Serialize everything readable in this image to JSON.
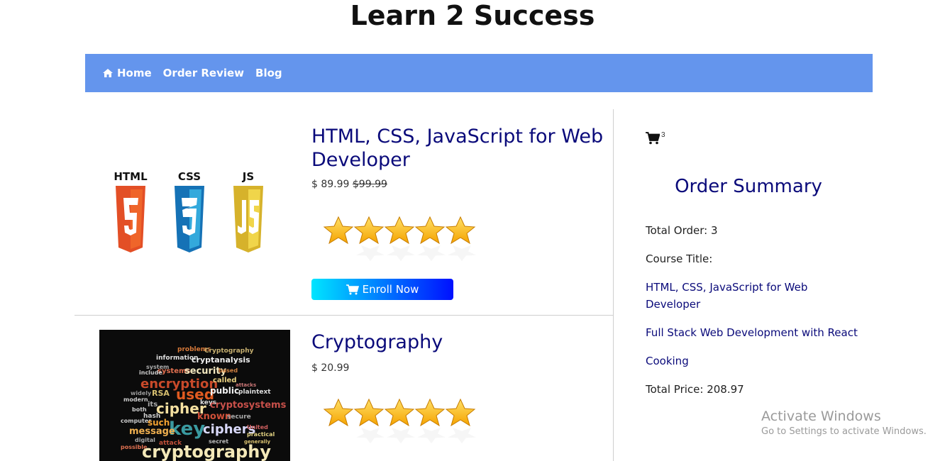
{
  "site": {
    "title": "Learn 2 Success"
  },
  "nav": {
    "home": "Home",
    "order_review": "Order Review",
    "blog": "Blog"
  },
  "courses": [
    {
      "title": "HTML, CSS, JavaScript for Web Developer",
      "price_prefix": "$ 89.99",
      "old_price": "$99.99",
      "rating": 5,
      "enroll_label": "Enroll Now",
      "logos": [
        "HTML",
        "CSS",
        "JS"
      ]
    },
    {
      "title": "Cryptography",
      "price_prefix": "$ 20.99",
      "rating": 5
    }
  ],
  "summary": {
    "cart_count": "3",
    "title": "Order Summary",
    "total_order": "Total Order: 3",
    "course_title_label": "Course Title:",
    "items": [
      "HTML, CSS, JavaScript for Web Developer",
      "Full Stack Web Development with React",
      "Cooking"
    ],
    "total_price": "Total Price: 208.97"
  },
  "watermark": {
    "line1": "Activate Windows",
    "line2": "Go to Settings to activate Windows."
  },
  "colors": {
    "nav_bg": "#6495ed",
    "heading_blue": "#0a0a7a",
    "button_start": "#00e5ff",
    "button_end": "#0010ff"
  }
}
